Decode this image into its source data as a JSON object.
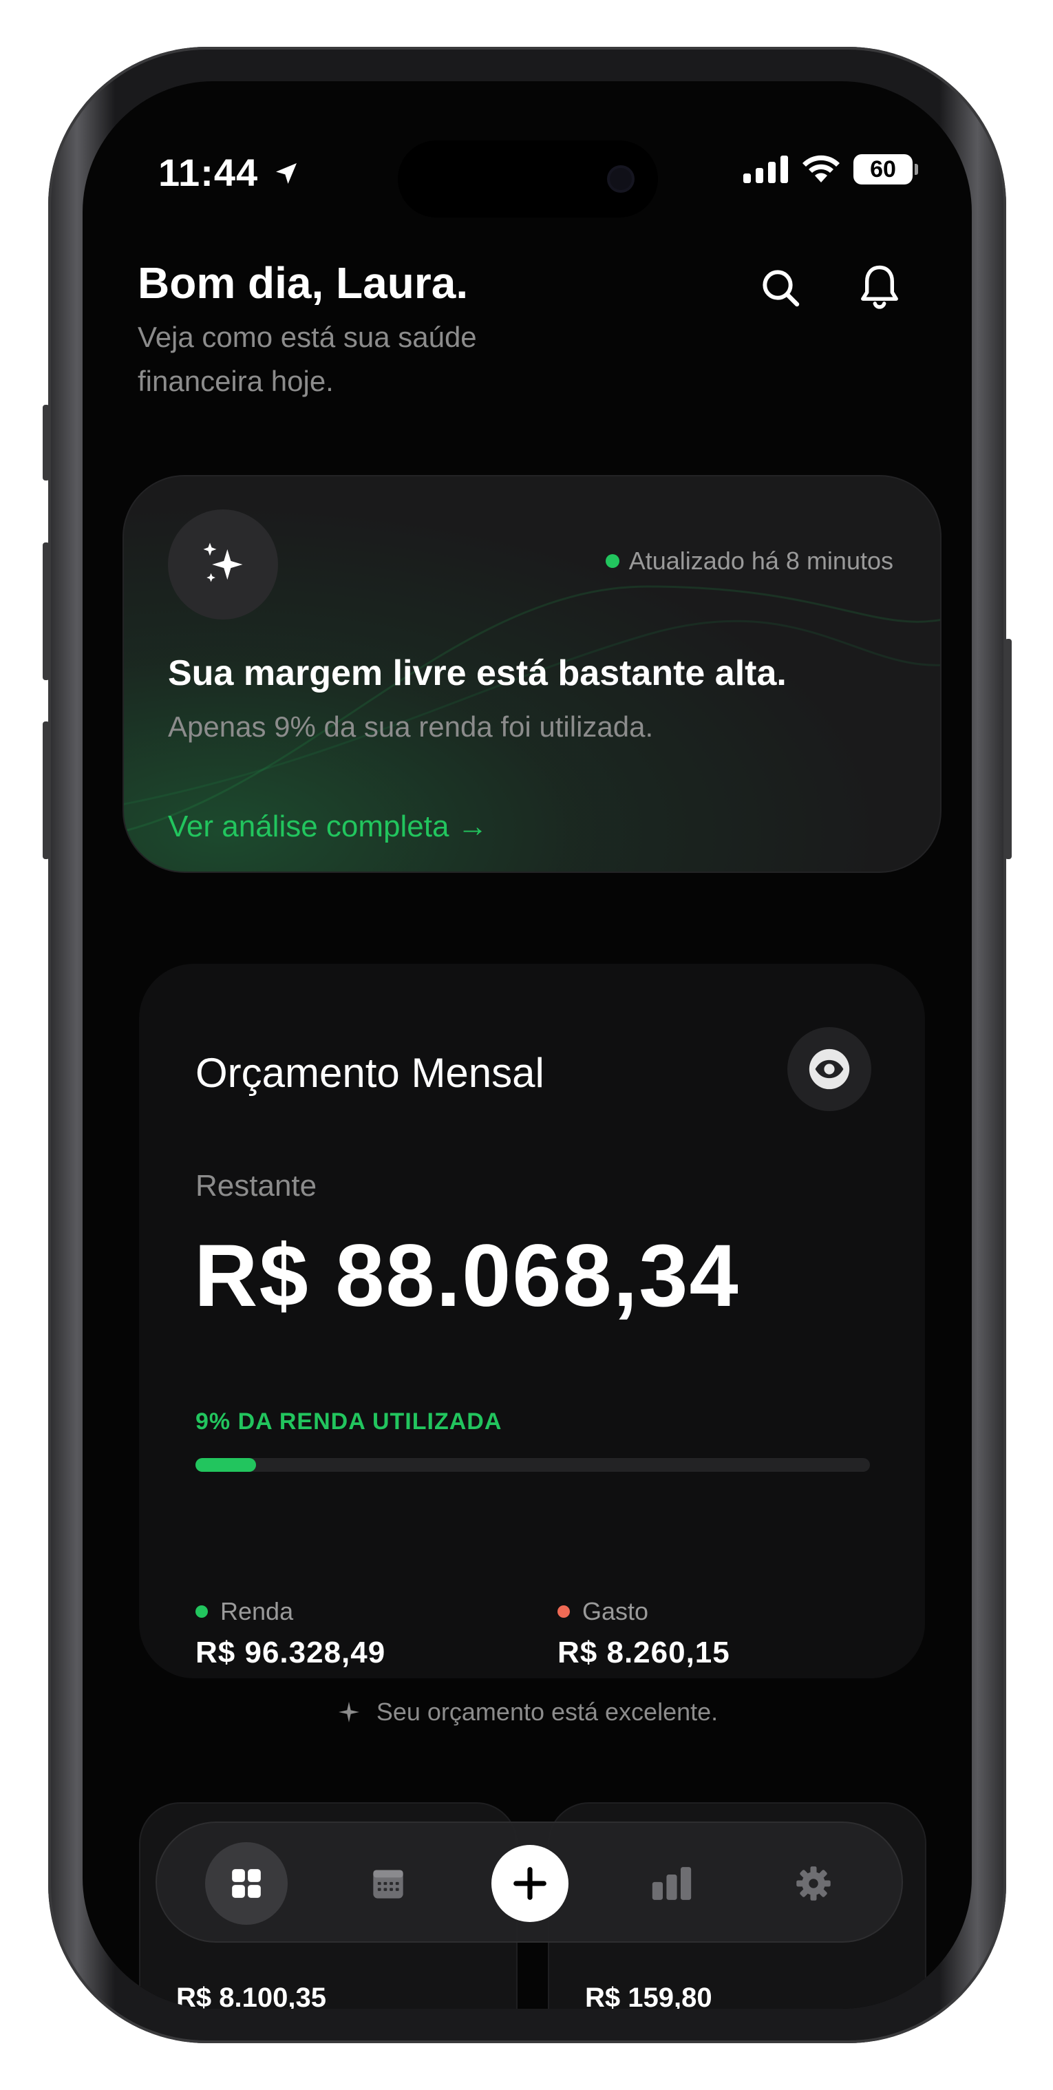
{
  "status_bar": {
    "time": "11:44",
    "battery": "60",
    "icons": [
      "location-arrow-icon",
      "signal-bars-icon",
      "wifi-icon",
      "battery-icon"
    ]
  },
  "header": {
    "greeting": "Bom dia, Laura.",
    "subtitle": "Veja como está sua saúde financeira hoje.",
    "icons": [
      "search-icon",
      "bell-icon"
    ]
  },
  "insight": {
    "icon": "sparkles-icon",
    "updated": "Atualizado há 8 minutos",
    "title": "Sua margem livre está bastante alta.",
    "subtitle": "Apenas 9% da sua renda foi utilizada.",
    "link": "Ver análise completa →"
  },
  "budget": {
    "title": "Orçamento Mensal",
    "remaining_label": "Restante",
    "remaining_value": "R$ 88.068,34",
    "usage_label": "9% DA RENDA UTILIZADA",
    "usage_fraction": 0.09,
    "income": {
      "label": "Renda",
      "value": "R$ 96.328,49",
      "color": "#22c55e"
    },
    "expense": {
      "label": "Gasto",
      "value": "R$ 8.260,15",
      "color": "#ef6a55"
    }
  },
  "tip": "Seu orçamento está excelente.",
  "cards": [
    {
      "value": "R$ 8.100,35"
    },
    {
      "value": "R$ 159,80"
    }
  ],
  "tabbar": {
    "items": [
      "dashboard-icon",
      "calendar-icon",
      "add-icon",
      "chart-icon",
      "settings-icon"
    ],
    "active": "dashboard-icon"
  },
  "colors": {
    "accent": "#22c55e",
    "expense": "#ef6a55",
    "background": "#050505",
    "card": "#0f0f10"
  }
}
